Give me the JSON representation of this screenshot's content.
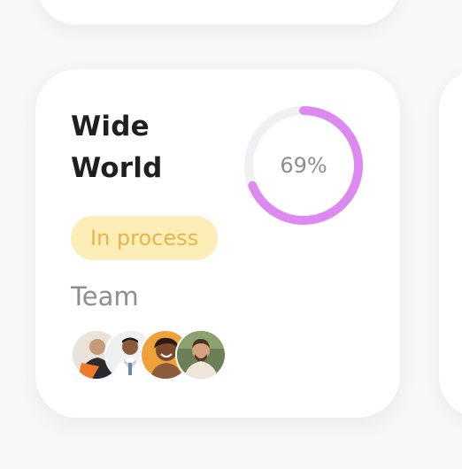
{
  "project": {
    "title_line1": "Wide",
    "title_line2": "World",
    "progress_label": "69%",
    "progress_fraction": 0.69,
    "status_label": "In process",
    "team_label": "Team",
    "team_members": [
      {
        "icon": "avatar-1"
      },
      {
        "icon": "avatar-2"
      },
      {
        "icon": "avatar-3"
      },
      {
        "icon": "avatar-4"
      }
    ]
  },
  "colors": {
    "accent_progress": "#dc8af2",
    "progress_track": "#f0f1f3",
    "status_bg": "#fdeeb8",
    "status_text": "#e9b445",
    "title_text": "#1e1e23",
    "muted_text": "#8a8f97"
  }
}
